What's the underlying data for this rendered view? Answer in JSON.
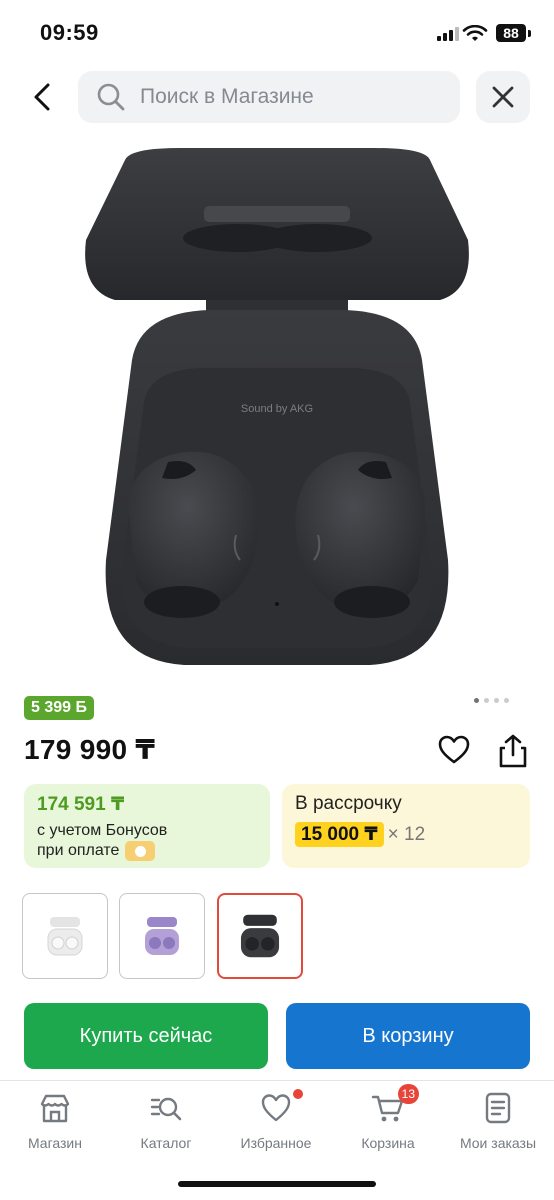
{
  "status_bar": {
    "time": "09:59",
    "battery": "88"
  },
  "search": {
    "placeholder": "Поиск в Магазине"
  },
  "product": {
    "bonus_badge": "5 399 Б",
    "price": "179 990 ₸",
    "image_caption": "Sound by AKG",
    "carousel_pages": 4,
    "carousel_active": 0
  },
  "bonus_card": {
    "amount": "174 591 ₸",
    "line1": "с учетом Бонусов",
    "line2": "при оплате"
  },
  "installment_card": {
    "title": "В рассрочку",
    "amount": "15 000 ₸",
    "multiplier": "× 12"
  },
  "variants": [
    {
      "color": "#f2f2f2",
      "selected": false
    },
    {
      "color": "#b3a0d6",
      "selected": false
    },
    {
      "color": "#3a3b3e",
      "selected": true
    }
  ],
  "actions": {
    "buy_label": "Купить сейчас",
    "cart_label": "В корзину"
  },
  "bottom_nav": {
    "items": [
      {
        "label": "Магазин",
        "icon": "store-icon"
      },
      {
        "label": "Каталог",
        "icon": "catalog-search-icon"
      },
      {
        "label": "Избранное",
        "icon": "heart-icon"
      },
      {
        "label": "Корзина",
        "icon": "cart-icon",
        "badge": "13"
      },
      {
        "label": "Мои заказы",
        "icon": "orders-icon"
      }
    ]
  },
  "colors": {
    "green": "#1ea84e",
    "blue": "#1676cf",
    "badge_red": "#e8453a",
    "bonus_green": "#5ba62d"
  }
}
